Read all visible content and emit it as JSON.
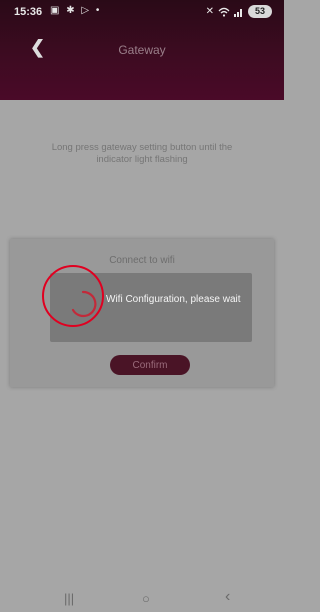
{
  "status_bar": {
    "time": "15:36",
    "left_icons": [
      "screenshot-icon",
      "gear-icon",
      "play-icon",
      "dot-icon"
    ],
    "right_icons": [
      "mute-icon",
      "wifi-icon",
      "signal-icon"
    ],
    "battery": "53"
  },
  "header": {
    "title": "Gateway",
    "back_icon": "chevron-left-icon"
  },
  "main": {
    "instruction": "Long press gateway setting button until the indicator light flashing"
  },
  "dialog": {
    "title": "Connect to wifi",
    "progress_text": "Wifi Configuration, please wait",
    "confirm_label": "Confirm"
  },
  "system_nav": {
    "recents": "|||",
    "home": "○",
    "back": "‹"
  },
  "colors": {
    "header_top": "#2a0a17",
    "header_bottom": "#4a0a28",
    "overlay_bg": "#a6a6a6",
    "dialog_bg": "#999999",
    "progress_bg": "#7a7a7a",
    "button_bg": "#4a1426",
    "highlight_ring": "#e00020"
  }
}
